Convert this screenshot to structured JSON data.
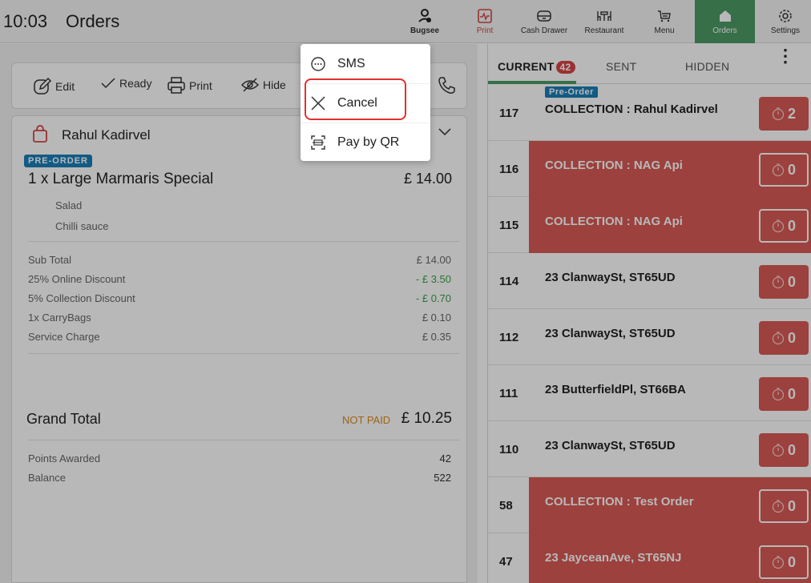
{
  "header": {
    "time": "10:03",
    "title": "Orders",
    "nav": [
      {
        "label": "Bugsee",
        "icon": "bugsee-icon"
      },
      {
        "label": "Print",
        "icon": "print-monitor-icon"
      },
      {
        "label": "Cash Drawer",
        "icon": "cash-drawer-icon"
      },
      {
        "label": "Restaurant",
        "icon": "restaurant-icon"
      },
      {
        "label": "Menu",
        "icon": "menu-cart-icon"
      },
      {
        "label": "Orders",
        "icon": "home-icon"
      },
      {
        "label": "Settings",
        "icon": "gear-icon"
      }
    ]
  },
  "actions": {
    "edit": "Edit",
    "ready": "Ready",
    "print": "Print",
    "hide": "Hide"
  },
  "order": {
    "customer": "Rahul Kadirvel",
    "badge": "PRE-ORDER",
    "item": "1 x  Large Marmaris Special",
    "item_price": "£ 14.00",
    "modifiers": [
      "Salad",
      "Chilli sauce"
    ],
    "summary": [
      {
        "label": "Sub Total",
        "value": "£ 14.00"
      },
      {
        "label": "25% Online Discount",
        "value": "- £ 3.50"
      },
      {
        "label": "5% Collection Discount",
        "value": "- £ 0.70"
      },
      {
        "label": "1x CarryBags",
        "value": "£ 0.10"
      },
      {
        "label": "Service Charge",
        "value": "£ 0.35"
      }
    ],
    "grand_label": "Grand Total",
    "paid_status": "NOT PAID",
    "grand_total": "£ 10.25",
    "points": [
      {
        "label": "Points Awarded",
        "value": "42"
      },
      {
        "label": "Balance",
        "value": "522"
      }
    ]
  },
  "popup": {
    "items": [
      "SMS",
      "Cancel",
      "Pay by QR"
    ]
  },
  "tabs": {
    "current": "CURRENT",
    "current_count": "42",
    "sent": "SENT",
    "hidden": "HIDDEN"
  },
  "orders": [
    {
      "num": "117",
      "text": "COLLECTION : Rahul Kadirvel",
      "timer": "2",
      "red": false,
      "pre": "Pre-Order"
    },
    {
      "num": "116",
      "text": "COLLECTION : NAG Api",
      "timer": "0",
      "red": true
    },
    {
      "num": "115",
      "text": "COLLECTION : NAG Api",
      "timer": "0",
      "red": true
    },
    {
      "num": "114",
      "text": "23 ClanwaySt, ST65UD",
      "timer": "0",
      "red": false
    },
    {
      "num": "112",
      "text": "23 ClanwaySt, ST65UD",
      "timer": "0",
      "red": false
    },
    {
      "num": "111",
      "text": "23 ButterfieldPl, ST66BA",
      "timer": "0",
      "red": false
    },
    {
      "num": "110",
      "text": "23 ClanwaySt, ST65UD",
      "timer": "0",
      "red": false
    },
    {
      "num": "58",
      "text": "COLLECTION : Test Order",
      "timer": "0",
      "red": true
    },
    {
      "num": "47",
      "text": "23 JayceanAve, ST65NJ",
      "timer": "0",
      "red": true
    }
  ],
  "colors": {
    "accent_green": "#4c9a64",
    "alert_red": "#d85a55",
    "preorder_blue": "#1a7fb8",
    "discount_green": "#3aa04a",
    "not_paid_orange": "#d98a1c"
  }
}
